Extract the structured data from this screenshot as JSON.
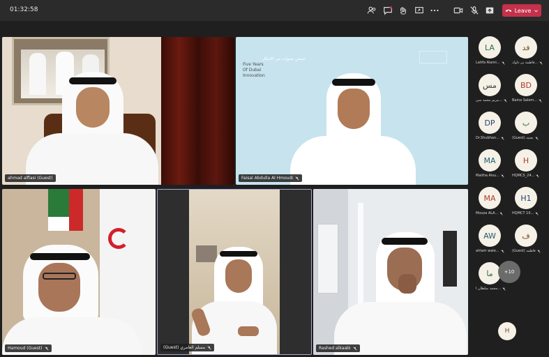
{
  "call": {
    "timer": "01:32:58",
    "leave_label": "Leave"
  },
  "toolbar": {
    "icons": [
      "people-icon",
      "chat-icon",
      "reactions-icon",
      "share-screen-icon",
      "more-options-icon",
      "camera-icon",
      "mic-off-icon",
      "share-tray-icon"
    ]
  },
  "tiles": [
    {
      "name": "ahmad alflasi (Guest)"
    },
    {
      "name": "Faisal Abdulla Al Hmoudi",
      "muted": true
    },
    {
      "name": "Hamoud (Guest)",
      "muted": true
    },
    {
      "name": "(Guest) مسلم العامري",
      "muted": true
    },
    {
      "name": "Rashed alkaabi",
      "muted": true
    }
  ],
  "slide": {
    "line1": "Five Years",
    "line2": "Of Dubai",
    "line3": "Innovation",
    "arabic": "خمس سنوات من الابتكار"
  },
  "participants": [
    {
      "initials": "LA",
      "name": "Latifa Alami...",
      "color": "#2a6a4a"
    },
    {
      "initials": "فد",
      "name": "فاطمة بن دلوك...",
      "color": "#7a4a22"
    },
    {
      "initials": "مس",
      "name": "مريم محمد سي...",
      "color": "#3a3a3a"
    },
    {
      "initials": "BD",
      "name": "Baina Salem...",
      "color": "#b03a2e"
    },
    {
      "initials": "DP",
      "name": "Dr.Shubhan...",
      "color": "#2f3f7a"
    },
    {
      "initials": "ب",
      "name": "(Guest) بخيته",
      "color": "#2a6a4a"
    },
    {
      "initials": "MA",
      "name": "Maitha Alsu...",
      "color": "#1f5b6e"
    },
    {
      "initials": "H",
      "name": "HQMCS_24...",
      "color": "#b03a2e"
    },
    {
      "initials": "MA",
      "name": "Mouza ALA...",
      "color": "#b03a2e"
    },
    {
      "initials": "H1",
      "name": "HQMCT 10...",
      "color": "#1f3f6e"
    },
    {
      "initials": "AW",
      "name": "ahlam wale...",
      "color": "#1f5b6e"
    },
    {
      "initials": "ف",
      "name": "(Guest) فاطمه",
      "color": "#7a4a22"
    },
    {
      "initials": "ما",
      "name": "محمد سلطان ا...",
      "color": "#2a6a4a"
    }
  ],
  "more_count": "+10",
  "self_avatar": "H",
  "colors": {
    "leave": "#c4314b",
    "bar": "#2b2b2b",
    "bg": "#1f1f1f"
  }
}
